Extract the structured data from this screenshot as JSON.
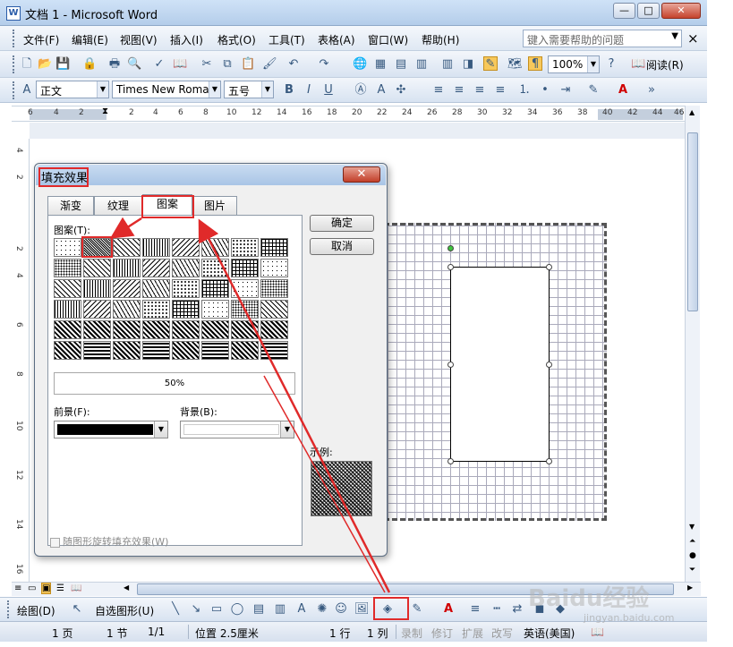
{
  "window": {
    "title": "文档 1 - Microsoft Word",
    "min": "—",
    "max": "□",
    "close": "✕"
  },
  "menubar": {
    "items": [
      "文件(F)",
      "编辑(E)",
      "视图(V)",
      "插入(I)",
      "格式(O)",
      "工具(T)",
      "表格(A)",
      "窗口(W)",
      "帮助(H)"
    ],
    "help_placeholder": "键入需要帮助的问题",
    "close_doc": "×"
  },
  "toolbar_standard": {
    "zoom": "100%",
    "read_label": "阅读(R)"
  },
  "toolbar_format": {
    "style": "正文",
    "font": "Times New Roman",
    "size": "五号",
    "bold": "B",
    "italic": "I",
    "underline": "U",
    "font_color": "A"
  },
  "ruler": {
    "marks": [
      "6",
      "4",
      "2",
      "2",
      "2",
      "4",
      "6",
      "8",
      "10",
      "12",
      "14",
      "16",
      "18",
      "20",
      "22",
      "24",
      "26",
      "28",
      "30",
      "32",
      "34",
      "36",
      "38",
      "40",
      "42",
      "44",
      "46"
    ]
  },
  "vruler": {
    "marks": [
      "4",
      "2",
      "2",
      "4",
      "6",
      "8",
      "10",
      "12",
      "14",
      "16"
    ]
  },
  "dialog": {
    "title": "填充效果",
    "close": "✕",
    "tabs": [
      "渐变",
      "纹理",
      "图案",
      "图片"
    ],
    "active_tab": "图案",
    "pattern_label": "图案(T):",
    "pattern_name": "50%",
    "foreground_label": "前景(F):",
    "background_label": "背景(B):",
    "foreground_color": "#000000",
    "background_color": "#ffffff",
    "ok": "确定",
    "cancel": "取消",
    "sample_label": "示例:",
    "rotate_label": "随图形旋转填充效果(W)"
  },
  "drawbar": {
    "draw_label": "绘图(D)",
    "autoshape_label": "自选图形(U)"
  },
  "statusbar": {
    "page": "1 页",
    "section": "1 节",
    "page_of": "1/1",
    "position": "位置 2.5厘米",
    "line": "1 行",
    "column": "1 列",
    "rec": "录制",
    "trk": "修订",
    "ext": "扩展",
    "ovr": "改写",
    "lang": "英语(美国)"
  },
  "watermark": {
    "brand": "Baidu经验",
    "url": "jingyan.baidu.com"
  }
}
